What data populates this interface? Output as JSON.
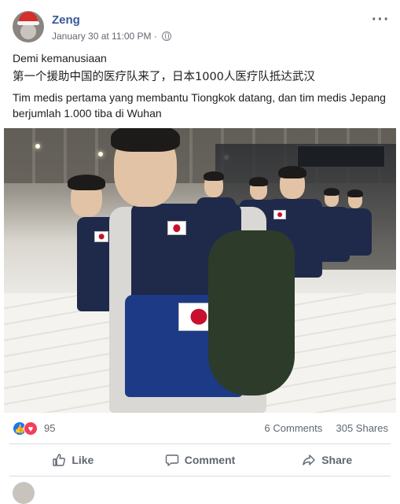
{
  "post": {
    "author": "Zeng",
    "timestamp": "January 30 at 11:00 PM",
    "separator": "·",
    "privacy_icon": "globe-icon",
    "more_label": "···"
  },
  "content": {
    "line1": "Demi kemanusiaan",
    "line2": "第一个援助中国的医疗队来了，日本1000人医疗队抵达武汉",
    "line3": "Tim medis pertama yang membantu Tiongkok datang, dan tim medis Jepang berjumlah 1.000 tiba di Wuhan"
  },
  "stats": {
    "reactions_count": "95",
    "comments": "6 Comments",
    "shares": "305 Shares"
  },
  "actions": {
    "like": "Like",
    "comment": "Comment",
    "share": "Share"
  },
  "colors": {
    "link": "#385898",
    "like_blue": "#1877f2",
    "love_red": "#f33e58"
  }
}
